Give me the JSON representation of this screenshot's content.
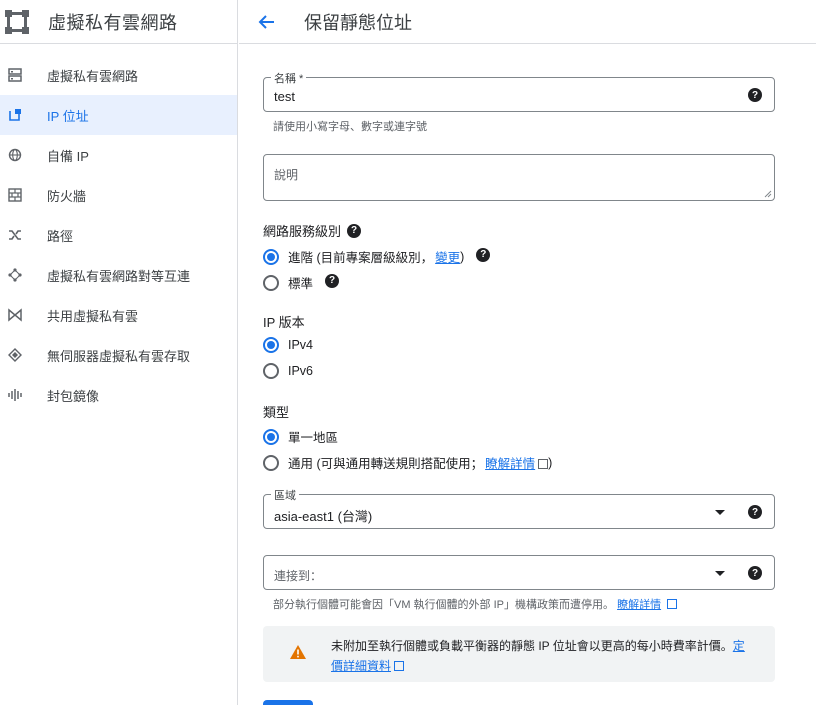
{
  "sidebar": {
    "title": "虛擬私有雲網路",
    "items": [
      {
        "label": "虛擬私有雲網路",
        "icon": "vpc-network-icon",
        "active": false
      },
      {
        "label": "IP 位址",
        "icon": "ip-address-icon",
        "active": true
      },
      {
        "label": "自備 IP",
        "icon": "globe-icon",
        "active": false
      },
      {
        "label": "防火牆",
        "icon": "firewall-icon",
        "active": false
      },
      {
        "label": "路徑",
        "icon": "routes-icon",
        "active": false
      },
      {
        "label": "虛擬私有雲網路對等互連",
        "icon": "peering-icon",
        "active": false
      },
      {
        "label": "共用虛擬私有雲",
        "icon": "shared-vpc-icon",
        "active": false
      },
      {
        "label": "無伺服器虛擬私有雲存取",
        "icon": "serverless-icon",
        "active": false
      },
      {
        "label": "封包鏡像",
        "icon": "packet-mirroring-icon",
        "active": false
      }
    ]
  },
  "header": {
    "title": "保留靜態位址"
  },
  "form": {
    "name": {
      "label": "名稱 *",
      "value": "test",
      "hint": "請使用小寫字母、數字或連字號"
    },
    "description": {
      "placeholder": "說明"
    },
    "tier": {
      "title": "網路服務級別",
      "options": [
        {
          "label": "進階 (目前專案層級級別，",
          "link": "變更",
          "suffix": ")",
          "checked": true
        },
        {
          "label": "標準",
          "checked": false
        }
      ]
    },
    "ip_version": {
      "title": "IP 版本",
      "options": [
        {
          "label": "IPv4",
          "checked": true
        },
        {
          "label": "IPv6",
          "checked": false
        }
      ]
    },
    "type": {
      "title": "類型",
      "options": [
        {
          "label": "單一地區",
          "checked": true
        },
        {
          "label": "通用 (可與通用轉送規則搭配使用；",
          "link": "瞭解詳情",
          "suffix": ")",
          "checked": false
        }
      ]
    },
    "region": {
      "label": "區域",
      "value": "asia-east1 (台灣)"
    },
    "attach": {
      "placeholder": "連接到：",
      "hint": "部分執行個體可能會因「VM 執行個體的外部 IP」機構政策而遭停用。",
      "hint_link": "瞭解詳情"
    },
    "warning": {
      "text": "未附加至執行個體或負載平衡器的靜態 IP 位址會以更高的每小時費率計價。",
      "link": "定價詳細資料"
    }
  },
  "colors": {
    "accent": "#1a73e8",
    "warning": "#e37400",
    "active_bg": "#e8f0fe"
  }
}
